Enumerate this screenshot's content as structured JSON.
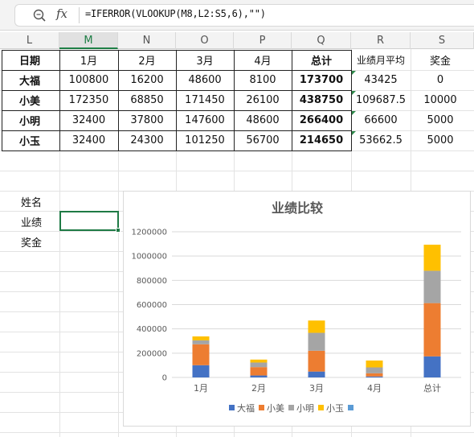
{
  "formula_bar": {
    "zoom_icon": "zoom-icon",
    "fx_label": "fx",
    "formula": "=IFERROR(VLOOKUP(M8,L2:S5,6),\"\")"
  },
  "columns": [
    "L",
    "M",
    "N",
    "O",
    "P",
    "Q",
    "R",
    "S"
  ],
  "selected_column": "M",
  "table": {
    "headers": [
      "日期",
      "1月",
      "2月",
      "3月",
      "4月",
      "总计",
      "业绩月平均",
      "奖金"
    ],
    "rows": [
      {
        "name": "大福",
        "m1": "100800",
        "m2": "16200",
        "m3": "48600",
        "m4": "8100",
        "total": "173700",
        "avg": "43425",
        "bonus": "0"
      },
      {
        "name": "小美",
        "m1": "172350",
        "m2": "68850",
        "m3": "171450",
        "m4": "26100",
        "total": "438750",
        "avg": "109687.5",
        "bonus": "10000"
      },
      {
        "name": "小明",
        "m1": "32400",
        "m2": "37800",
        "m3": "147600",
        "m4": "48600",
        "total": "266400",
        "avg": "66600",
        "bonus": "5000"
      },
      {
        "name": "小玉",
        "m1": "32400",
        "m2": "24300",
        "m3": "101250",
        "m4": "56700",
        "total": "214650",
        "avg": "53662.5",
        "bonus": "5000"
      }
    ]
  },
  "lookup_labels": {
    "name": "姓名",
    "performance": "业绩",
    "bonus": "奖金"
  },
  "chart_data": {
    "type": "bar",
    "stacked": true,
    "title": "业绩比较",
    "categories": [
      "1月",
      "2月",
      "3月",
      "4月",
      "总计"
    ],
    "series": [
      {
        "name": "大福",
        "color": "#4472c4",
        "values": [
          100800,
          16200,
          48600,
          8100,
          173700
        ]
      },
      {
        "name": "小美",
        "color": "#ed7d31",
        "values": [
          172350,
          68850,
          171450,
          26100,
          438750
        ]
      },
      {
        "name": "小明",
        "color": "#a5a5a5",
        "values": [
          32400,
          37800,
          147600,
          48600,
          266400
        ]
      },
      {
        "name": "小玉",
        "color": "#ffc000",
        "values": [
          32400,
          24300,
          101250,
          56700,
          214650
        ]
      },
      {
        "name": "",
        "color": "#5b9bd5",
        "values": [
          0,
          0,
          0,
          0,
          0
        ]
      }
    ],
    "y_ticks": [
      "0",
      "200000",
      "400000",
      "600000",
      "800000",
      "1000000",
      "1200000"
    ],
    "ylim": [
      0,
      1200000
    ],
    "grid": true,
    "legend_position": "bottom"
  }
}
